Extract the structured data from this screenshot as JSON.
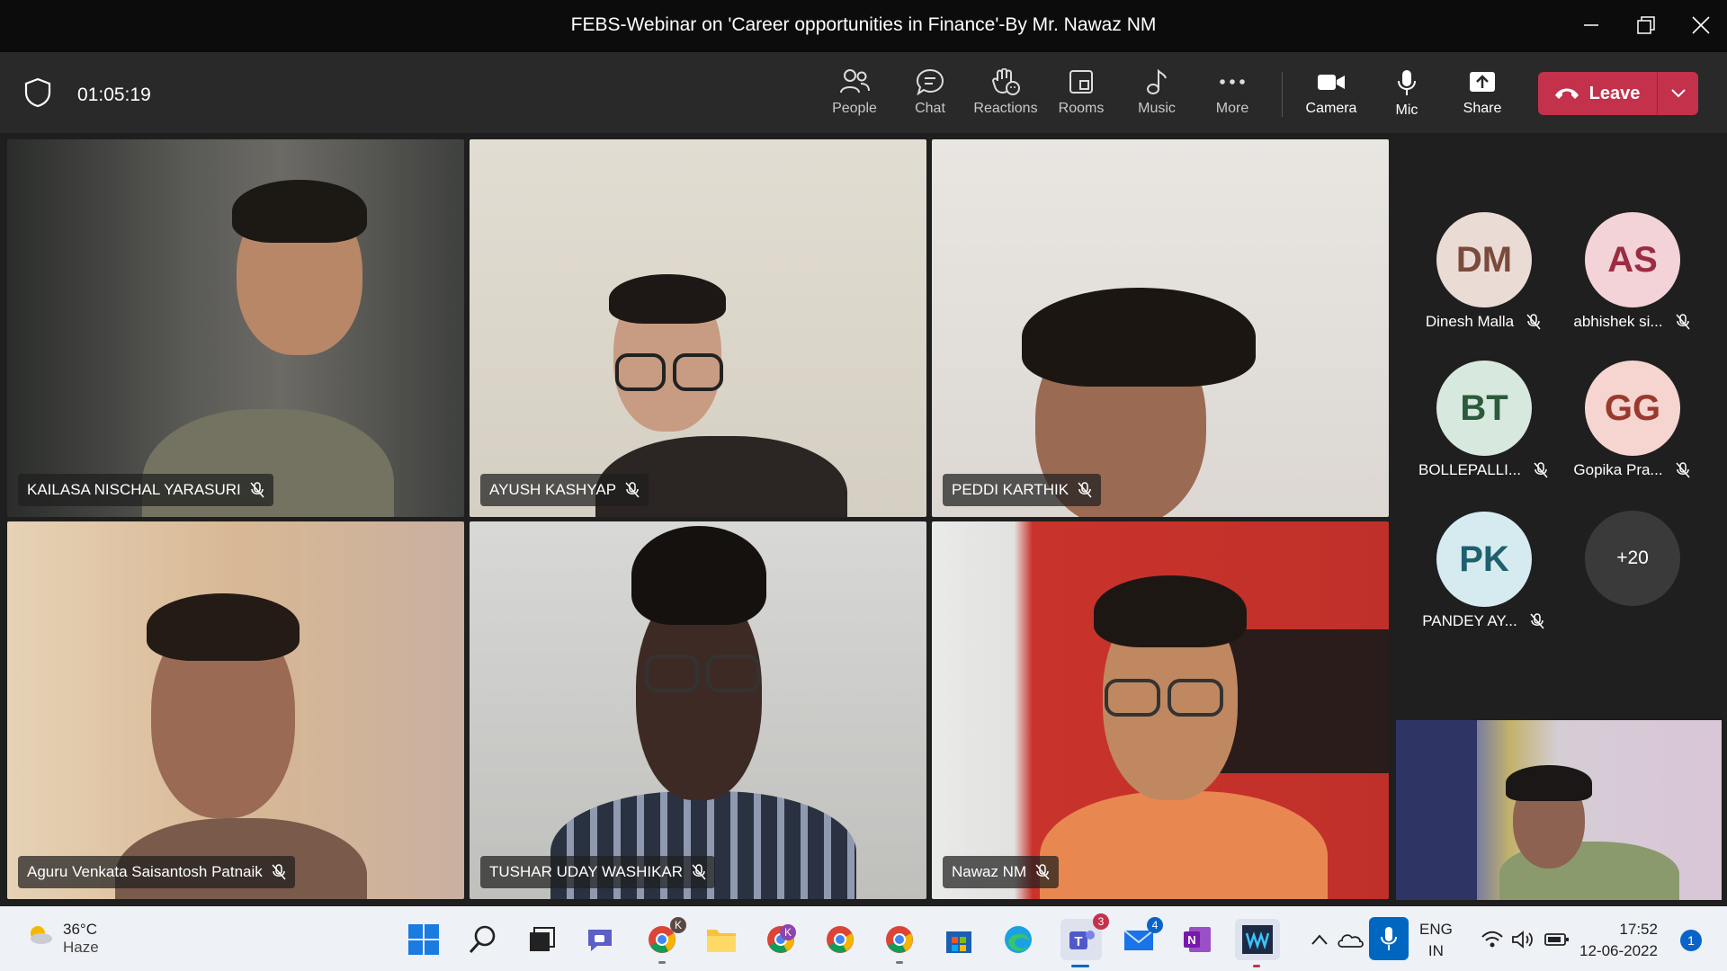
{
  "window": {
    "title": "FEBS-Webinar on 'Career opportunities in Finance'-By Mr. Nawaz NM"
  },
  "toolbar": {
    "timer": "01:05:19",
    "buttons": {
      "people": "People",
      "chat": "Chat",
      "reactions": "Reactions",
      "rooms": "Rooms",
      "music": "Music",
      "more": "More",
      "camera": "Camera",
      "mic": "Mic",
      "share": "Share"
    },
    "leave_label": "Leave"
  },
  "video_tiles": [
    {
      "name": "KAILASA NISCHAL YARASURI",
      "muted": true
    },
    {
      "name": "AYUSH KASHYAP",
      "muted": true
    },
    {
      "name": "PEDDI KARTHIK",
      "muted": true
    },
    {
      "name": "Aguru Venkata Saisantosh Patnaik",
      "muted": true
    },
    {
      "name": "TUSHAR UDAY WASHIKAR",
      "muted": true
    },
    {
      "name": "Nawaz NM",
      "muted": true
    }
  ],
  "participants_panel": {
    "avatars": [
      {
        "initials": "DM",
        "name": "Dinesh Malla",
        "color": "#eadbd5",
        "text_color": "#7a4a3c"
      },
      {
        "initials": "AS",
        "name": "abhishek si...",
        "color": "#f3d3d8",
        "text_color": "#9b2c42"
      },
      {
        "initials": "BT",
        "name": "BOLLEPALLI...",
        "color": "#d7e8de",
        "text_color": "#2c5a3c"
      },
      {
        "initials": "GG",
        "name": "Gopika Pra...",
        "color": "#f6d4d0",
        "text_color": "#9a3a2d"
      },
      {
        "initials": "PK",
        "name": "PANDEY AY...",
        "color": "#d6ebf0",
        "text_color": "#1f5f6e"
      }
    ],
    "overflow_count": "+20"
  },
  "taskbar": {
    "weather_temp": "36°C",
    "weather_condition": "Haze",
    "language": "ENG",
    "region": "IN",
    "time": "17:52",
    "date": "12-06-2022",
    "notification_count": "1",
    "badges": {
      "chrome_profile_k": "K",
      "chrome_profile_k2": "K",
      "teams": "3",
      "mail": "4"
    }
  },
  "colors": {
    "leave": "#c4314b",
    "toolbar": "#292929",
    "titlebar": "#0c0c0c",
    "taskbar": "#eef1f6"
  }
}
